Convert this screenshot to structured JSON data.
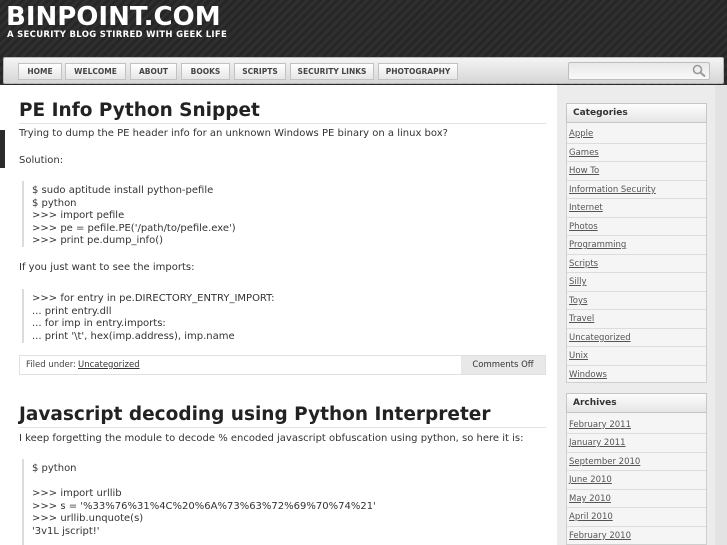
{
  "site": {
    "title": "BINPOINT.COM",
    "tagline": "A SECURITY BLOG STIRRED WITH GEEK LIFE"
  },
  "nav": {
    "items": [
      "HOME",
      "WELCOME",
      "ABOUT",
      "BOOKS",
      "SCRIPTS",
      "SECURITY LINKS",
      "PHOTOGRAPHY"
    ]
  },
  "search": {
    "value": "",
    "placeholder": ""
  },
  "posts": [
    {
      "title": "PE Info Python Snippet",
      "intro": "Trying to dump the PE header info for an unknown Windows PE binary on a linux box?",
      "solution": "Solution:",
      "code1": [
        "$ sudo aptitude install python-pefile",
        "$ python",
        ">>> import pefile",
        ">>> pe = pefile.PE('/path/to/pefile.exe')",
        ">>> print pe.dump_info()"
      ],
      "middle": "If you just want to see the imports:",
      "code2": [
        ">>> for entry in pe.DIRECTORY_ENTRY_IMPORT:",
        "... print entry.dll",
        "... for imp in entry.imports:",
        "... print '\\t', hex(imp.address), imp.name"
      ],
      "filed_label": "Filed under:",
      "category": "Uncategorized",
      "comments": "Comments Off"
    },
    {
      "title": "Javascript decoding using Python Interpreter",
      "intro": "I keep forgetting the module to decode % encoded javascript obfuscation using python, so here it is:",
      "code1": [
        "$ python",
        "",
        ">>> import urllib",
        ">>> s = '%33%76%31%4C%20%6A%73%63%72%69%70%74%21'",
        ">>> urllib.unquote(s)",
        "'3v1L jscript!'"
      ]
    }
  ],
  "sidebar": {
    "categories_title": "Categories",
    "categories": [
      "Apple",
      "Games",
      "How To",
      "Information Security",
      "Internet",
      "Photos",
      "Programming",
      "Scripts",
      "Silly",
      "Toys",
      "Travel",
      "Uncategorized",
      "Unix",
      "Windows"
    ],
    "archives_title": "Archives",
    "archives": [
      "February 2011",
      "January 2011",
      "September 2010",
      "June 2010",
      "May 2010",
      "April 2010",
      "February 2010"
    ]
  }
}
